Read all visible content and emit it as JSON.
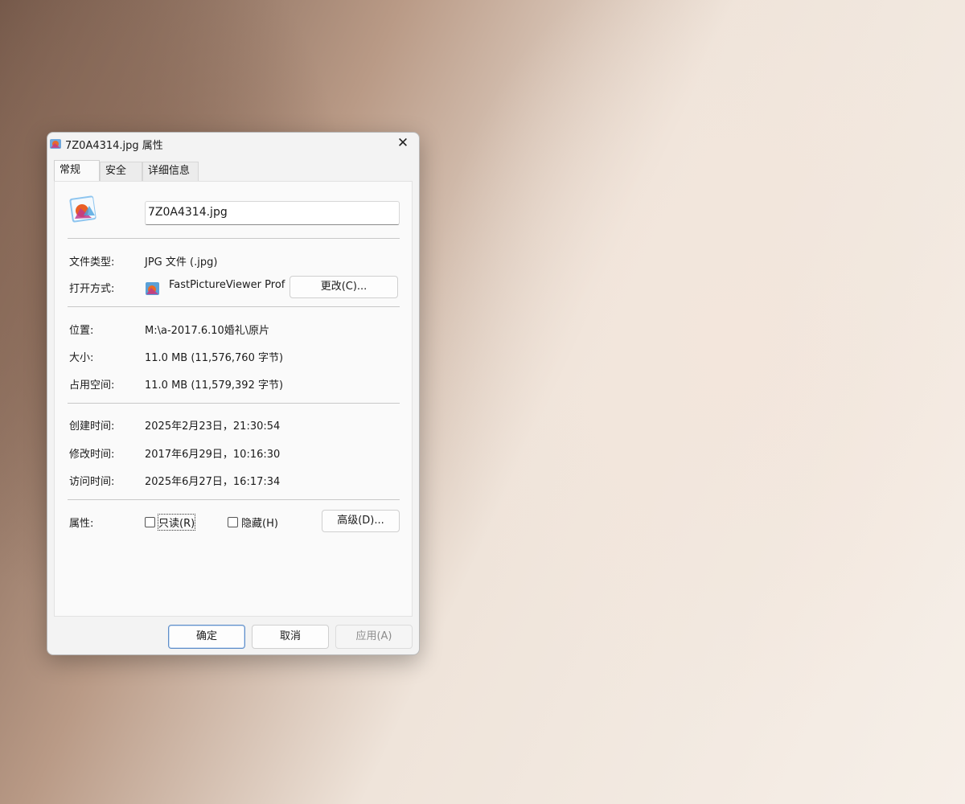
{
  "dialog": {
    "title": "7Z0A4314.jpg 属性",
    "close_glyph": "✕",
    "title_icon": "image-file-icon"
  },
  "tabs": [
    {
      "label": "常规",
      "active": true
    },
    {
      "label": "安全",
      "active": false
    },
    {
      "label": "详细信息",
      "active": false
    }
  ],
  "general": {
    "file_icon": "jpg-file-icon",
    "file_name": "7Z0A4314.jpg",
    "type_label": "文件类型:",
    "type_value": "JPG 文件 (.jpg)",
    "open_with_label": "打开方式:",
    "open_with_app": "FastPictureViewer Prof",
    "open_with_icon": "fastpictureviewer-icon",
    "change_button": "更改(C)...",
    "location_label": "位置:",
    "location_value": "M:\\a-2017.6.10婚礼\\原片",
    "size_label": "大小:",
    "size_value": "11.0 MB (11,576,760 字节)",
    "disk_size_label": "占用空间:",
    "disk_size_value": "11.0 MB (11,579,392 字节)",
    "created_label": "创建时间:",
    "created_value": "2025年2月23日，21:30:54",
    "modified_label": "修改时间:",
    "modified_value": "2017年6月29日，10:16:30",
    "accessed_label": "访问时间:",
    "accessed_value": "2025年6月27日，16:17:34",
    "attributes_label": "属性:",
    "readonly_label": "只读(R)",
    "readonly_checked": false,
    "hidden_label": "隐藏(H)",
    "hidden_checked": false,
    "advanced_button": "高级(D)..."
  },
  "footer": {
    "ok": "确定",
    "cancel": "取消",
    "apply": "应用(A)"
  }
}
